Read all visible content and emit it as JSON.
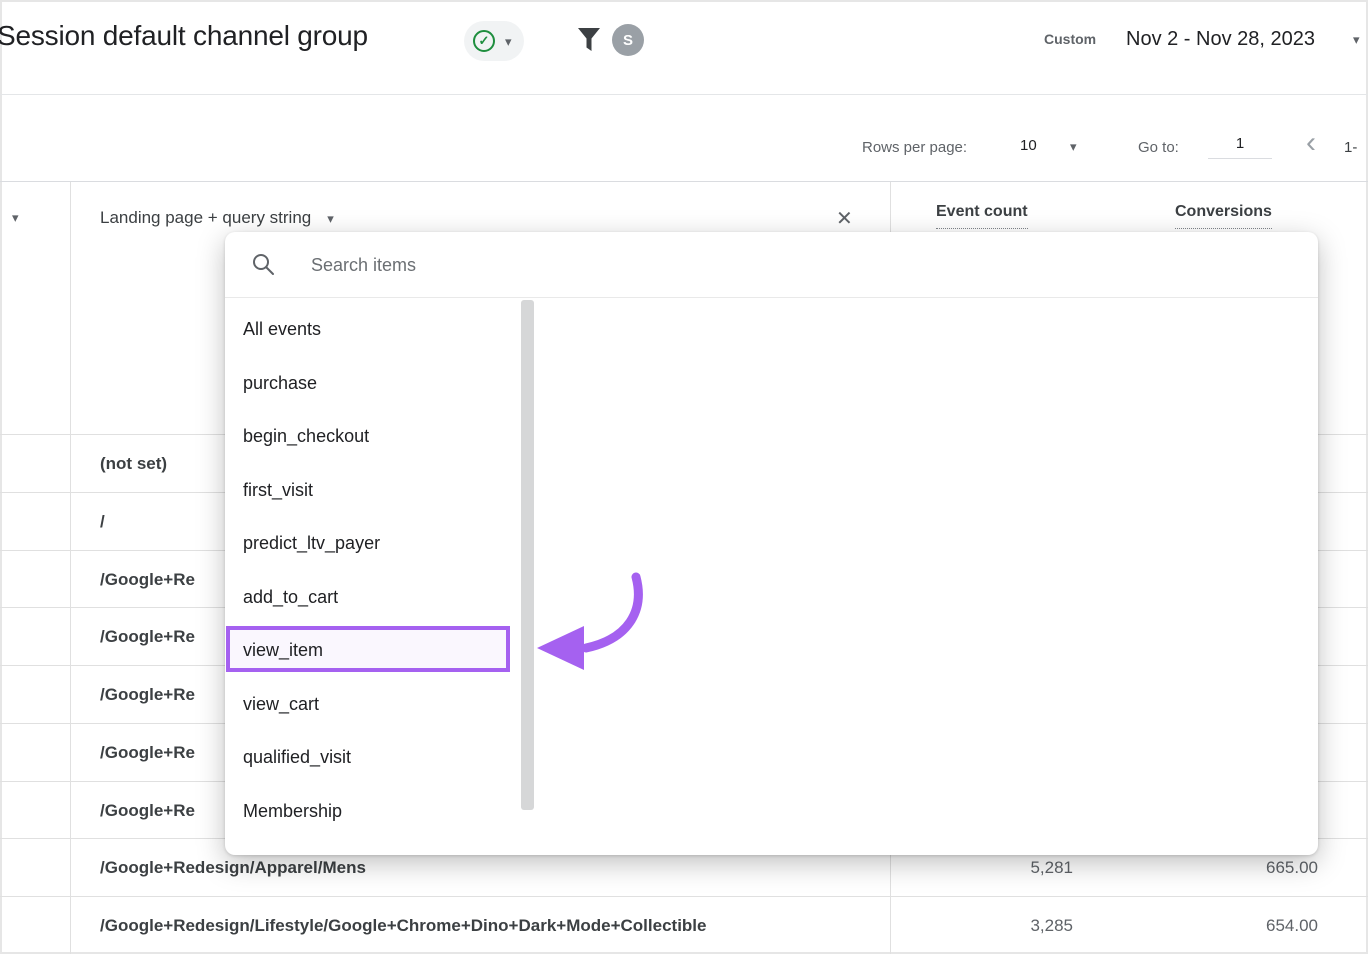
{
  "colors": {
    "accent_purple": "#a561f0",
    "check_green": "#1e8e3e"
  },
  "icons": {
    "check": "✓",
    "caret_down": "▾",
    "close": "✕",
    "chevron_left": "‹",
    "filter": "filter-funnel",
    "search": "magnifier"
  },
  "header": {
    "title": "Session default channel group",
    "avatar_initial": "S",
    "date_label": "Custom",
    "date_range": "Nov 2 - Nov 28, 2023"
  },
  "pagination": {
    "rows_per_page_label": "Rows per page:",
    "rows_per_page_value": "10",
    "go_to_label": "Go to:",
    "go_to_value": "1",
    "range_start": "1-"
  },
  "table": {
    "dimension_header": "Landing page + query string",
    "metrics": [
      "Event count",
      "Conversions"
    ],
    "rows": [
      {
        "landing": "(not set)",
        "event_count": "",
        "conversions": ""
      },
      {
        "landing": "/",
        "event_count": "",
        "conversions": ""
      },
      {
        "landing": "/Google+Re",
        "event_count": "",
        "conversions": ""
      },
      {
        "landing": "/Google+Re",
        "event_count": "",
        "conversions": ""
      },
      {
        "landing": "/Google+Re",
        "event_count": "",
        "conversions": ""
      },
      {
        "landing": "/Google+Re",
        "event_count": "",
        "conversions": ""
      },
      {
        "landing": "/Google+Re",
        "event_count": "",
        "conversions": ""
      },
      {
        "landing": "/Google+Redesign/Apparel/Mens",
        "event_count": "5,281",
        "conversions": "665.00"
      },
      {
        "landing": "/Google+Redesign/Lifestyle/Google+Chrome+Dino+Dark+Mode+Collectible",
        "event_count": "3,285",
        "conversions": "654.00"
      }
    ]
  },
  "dialog": {
    "search_placeholder": "Search items",
    "items": [
      "All events",
      "purchase",
      "begin_checkout",
      "first_visit",
      "predict_ltv_payer",
      "add_to_cart",
      "view_item",
      "view_cart",
      "qualified_visit",
      "Membership"
    ],
    "highlighted_item": "view_item"
  }
}
